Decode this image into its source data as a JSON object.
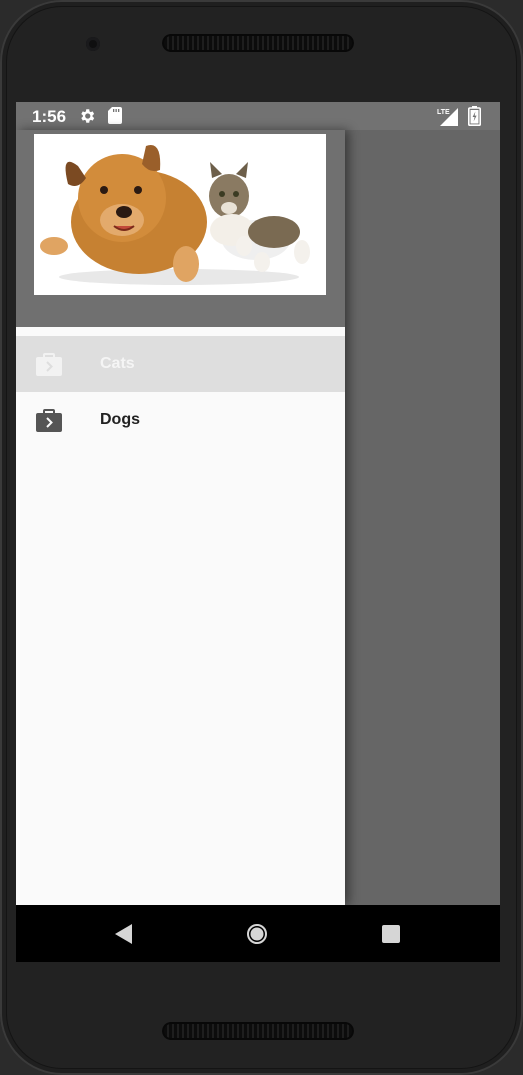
{
  "status_bar": {
    "time": "1:56",
    "network": "LTE",
    "icons": [
      "gear-icon",
      "sd-card-icon",
      "signal-icon",
      "battery-icon"
    ]
  },
  "drawer": {
    "header_image": "dog-and-cat-photo",
    "items": [
      {
        "label": "Cats",
        "icon": "briefcase-icon",
        "selected": true
      },
      {
        "label": "Dogs",
        "icon": "briefcase-icon",
        "selected": false
      }
    ]
  },
  "nav_bar": {
    "icons": [
      "back-icon",
      "home-icon",
      "recents-icon"
    ]
  },
  "colors": {
    "scrim": "#666666",
    "drawer_bg": "#fafafa",
    "selected_item_bg": "#dedede",
    "status_bar": "#727272",
    "nav_bar": "#000000"
  }
}
